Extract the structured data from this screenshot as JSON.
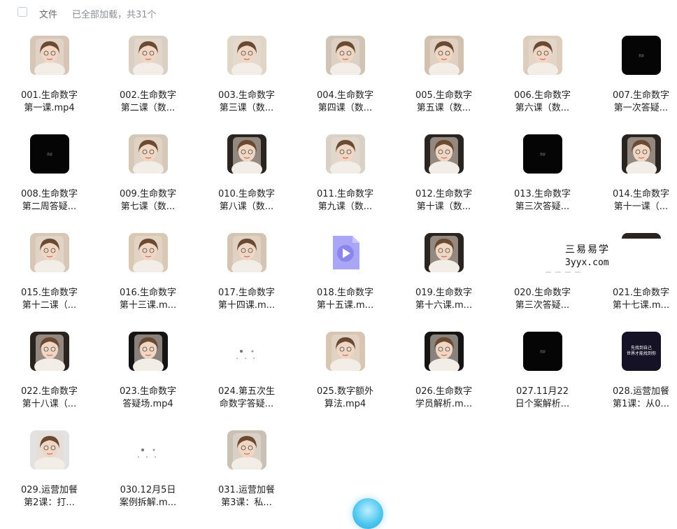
{
  "header": {
    "select_all": "",
    "file_label": "文件",
    "status": "已全部加载，共31个"
  },
  "files": [
    {
      "line1": "001.生命数字",
      "line2": "第一课.mp4",
      "thumb": "face",
      "color": "#d8c5b8"
    },
    {
      "line1": "002.生命数字",
      "line2": "第二课（数...",
      "thumb": "face",
      "color": "#d9cfc2"
    },
    {
      "line1": "003.生命数字",
      "line2": "第三课（数...",
      "thumb": "face",
      "color": "#e0d6c8"
    },
    {
      "line1": "004.生命数字",
      "line2": "第四课（数...",
      "thumb": "face",
      "color": "#cfc4b6"
    },
    {
      "line1": "005.生命数字",
      "line2": "第五课（数...",
      "thumb": "face",
      "color": "#d2c1ae"
    },
    {
      "line1": "006.生命数字",
      "line2": "第六课（数...",
      "thumb": "face",
      "color": "#dccdbd"
    },
    {
      "line1": "007.生命数字",
      "line2": "第一次答疑...",
      "thumb": "black",
      "color": "#050505"
    },
    {
      "line1": "008.生命数字",
      "line2": "第二周答疑...",
      "thumb": "black",
      "color": "#050505"
    },
    {
      "line1": "009.生命数字",
      "line2": "第七课（数...",
      "thumb": "face",
      "color": "#d6c8b9"
    },
    {
      "line1": "010.生命数字",
      "line2": "第八课（数...",
      "thumb": "face",
      "color": "#2a2420"
    },
    {
      "line1": "011.生命数字",
      "line2": "第九课（数...",
      "thumb": "face",
      "color": "#d9d0c6"
    },
    {
      "line1": "012.生命数字",
      "line2": "第十课（数...",
      "thumb": "face",
      "color": "#2a2420"
    },
    {
      "line1": "013.生命数字",
      "line2": "第三次答疑...",
      "thumb": "black",
      "color": "#050505"
    },
    {
      "line1": "014.生命数字",
      "line2": "第十一课（...",
      "thumb": "face",
      "color": "#2a2420"
    },
    {
      "line1": "015.生命数字",
      "line2": "第十二课（...",
      "thumb": "face",
      "color": "#d7c7b6"
    },
    {
      "line1": "016.生命数字",
      "line2": "第十三课.m...",
      "thumb": "face",
      "color": "#d9c8b4"
    },
    {
      "line1": "017.生命数字",
      "line2": "第十四课.m...",
      "thumb": "face",
      "color": "#d4c4b2"
    },
    {
      "line1": "018.生命数字",
      "line2": "第十五课.m...",
      "thumb": "video",
      "color": "#a9a6f5"
    },
    {
      "line1": "019.生命数字",
      "line2": "第十六课.m...",
      "thumb": "face",
      "color": "#2a2420"
    },
    {
      "line1": "020.生命数字",
      "line2": "第三次答疑...",
      "thumb": "none",
      "color": "#ffffff"
    },
    {
      "line1": "021.生命数字",
      "line2": "第十七课.m...",
      "thumb": "partial",
      "color": "#2a2420"
    },
    {
      "line1": "022.生命数字",
      "line2": "第十八课（...",
      "thumb": "face",
      "color": "#2a2420"
    },
    {
      "line1": "023.生命数字",
      "line2": "答疑场.mp4",
      "thumb": "face",
      "color": "#141414"
    },
    {
      "line1": "024.第五次生",
      "line2": "命数字答疑...",
      "thumb": "dots",
      "color": "#ffffff"
    },
    {
      "line1": "025.数字额外",
      "line2": "算法.mp4",
      "thumb": "face",
      "color": "#d8c6b3"
    },
    {
      "line1": "026.生命数字",
      "line2": "学员解析.m...",
      "thumb": "face",
      "color": "#141414"
    },
    {
      "line1": "027.11月22",
      "line2": "日个案解析...",
      "thumb": "black",
      "color": "#050505"
    },
    {
      "line1": "028.运营加餐",
      "line2": "第1课：从0...",
      "thumb": "text",
      "color": "#151226"
    },
    {
      "line1": "029.运营加餐",
      "line2": "第2课：打...",
      "thumb": "face",
      "color": "#e2e2e2"
    },
    {
      "line1": "030.12月5日",
      "line2": "案例拆解.m...",
      "thumb": "dots",
      "color": "#ffffff"
    },
    {
      "line1": "031.运营加餐",
      "line2": "第3课：私...",
      "thumb": "face",
      "color": "#c9c1b5"
    }
  ],
  "watermark": {
    "line1": "三易易学",
    "line2": "3yyx.com"
  },
  "thumb_labels": {
    "black": "黑屏",
    "text": "先找到自己 世界才能找到你"
  }
}
